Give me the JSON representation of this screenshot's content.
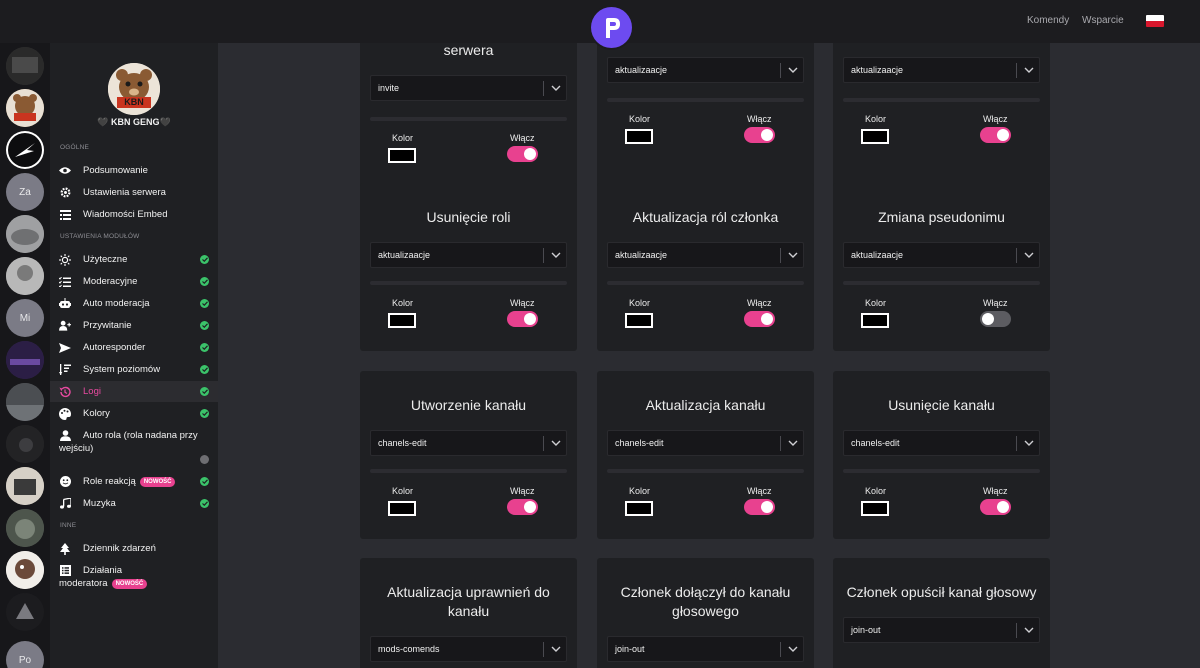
{
  "topbar": {
    "links": [
      {
        "label": "Komendy"
      },
      {
        "label": "Wsparcie"
      }
    ],
    "flag_colors": [
      "#ffffff",
      "#d8172d"
    ],
    "accent_color": "#6d4bf0"
  },
  "servers": [
    {
      "type": "image",
      "bg": "#3a3a3a"
    },
    {
      "type": "image",
      "bg": "#b7864f"
    },
    {
      "type": "image",
      "bg": "#0d0d0f"
    },
    {
      "type": "text",
      "label": "Za",
      "bg": "#7b7b86"
    },
    {
      "type": "image",
      "bg": "#8e8f91"
    },
    {
      "type": "image",
      "bg": "#a4a4a4"
    },
    {
      "type": "text",
      "label": "Mi",
      "bg": "#7b7b86"
    },
    {
      "type": "image",
      "bg": "#3a2a5a"
    },
    {
      "type": "image",
      "bg": "#5d6063"
    },
    {
      "type": "image",
      "bg": "#2a2a2c"
    },
    {
      "type": "image",
      "bg": "#c9c2b8"
    },
    {
      "type": "image",
      "bg": "#5a6159"
    },
    {
      "type": "image",
      "bg": "#f1eee9"
    },
    {
      "type": "image",
      "bg": "#1c1c1f"
    },
    {
      "type": "text",
      "label": "Po",
      "bg": "#7b7b86"
    }
  ],
  "sidebar": {
    "guild_name": "🖤 KBN GENG🖤",
    "avatar_text": "KBN",
    "sections": {
      "general": "OGÓLNE",
      "modules": "USTAWIENIA MODUŁÓW",
      "other": "INNE"
    },
    "general_items": [
      {
        "label": "Podsumowanie",
        "icon": "eye-icon"
      },
      {
        "label": "Ustawienia serwera",
        "icon": "gear-icon"
      },
      {
        "label": "Wiadomości Embed",
        "icon": "list-icon"
      }
    ],
    "module_items": [
      {
        "label": "Użyteczne",
        "icon": "sun-icon",
        "enabled": true
      },
      {
        "label": "Moderacyjne",
        "icon": "list-check-icon",
        "enabled": true
      },
      {
        "label": "Auto moderacja",
        "icon": "robot-icon",
        "enabled": true
      },
      {
        "label": "Przywitanie",
        "icon": "user-plus-icon",
        "enabled": true
      },
      {
        "label": "Autoresponder",
        "icon": "send-icon",
        "enabled": true
      },
      {
        "label": "System poziomów",
        "icon": "sort-icon",
        "enabled": true
      },
      {
        "label": "Logi",
        "icon": "history-icon",
        "enabled": true,
        "active": true
      },
      {
        "label": "Kolory",
        "icon": "palette-icon",
        "enabled": true
      },
      {
        "label": "Auto rola (rola nadana przy",
        "label2": "wejściu)",
        "icon": "user-icon",
        "enabled": false
      },
      {
        "label": "Role reakcją",
        "icon": "smile-icon",
        "enabled": true,
        "badge": "NOWOŚĆ"
      },
      {
        "label": "Muzyka",
        "icon": "music-icon",
        "enabled": true
      }
    ],
    "other_items": [
      {
        "label": "Dziennik zdarzeń",
        "icon": "tree-icon"
      },
      {
        "label": "Działania",
        "label2": "moderatora",
        "icon": "list-alt-icon",
        "badge": "NOWOŚĆ"
      }
    ]
  },
  "labels": {
    "kolor": "Kolor",
    "wlacz": "Włącz"
  },
  "cards": [
    {
      "title": "serwera",
      "channel": "invite",
      "enabled": true
    },
    {
      "title": "",
      "channel": "aktualizaacje",
      "enabled": true
    },
    {
      "title": "",
      "channel": "aktualizaacje",
      "enabled": true
    },
    {
      "title": "Usunięcie roli",
      "channel": "aktualizaacje",
      "enabled": true
    },
    {
      "title": "Aktualizacja ról członka",
      "channel": "aktualizaacje",
      "enabled": true
    },
    {
      "title": "Zmiana pseudonimu",
      "channel": "aktualizaacje",
      "enabled": false
    },
    {
      "title": "Utworzenie kanału",
      "channel": "chanels-edit",
      "enabled": true
    },
    {
      "title": "Aktualizacja kanału",
      "channel": "chanels-edit",
      "enabled": true
    },
    {
      "title": "Usunięcie kanału",
      "channel": "chanels-edit",
      "enabled": true
    },
    {
      "title": "Aktualizacja uprawnień do kanału",
      "channel": "mods-comends",
      "enabled": true
    },
    {
      "title": "Członek dołączył do kanału głosowego",
      "channel": "join-out",
      "enabled": true
    },
    {
      "title": "Członek opuścił kanał głosowy",
      "channel": "join-out",
      "enabled": true
    }
  ],
  "colors": {
    "toggle_on": "#e8418f",
    "toggle_off": "#5c5c61",
    "status_ok": "#3bc36a",
    "active_text": "#e84aa0"
  }
}
